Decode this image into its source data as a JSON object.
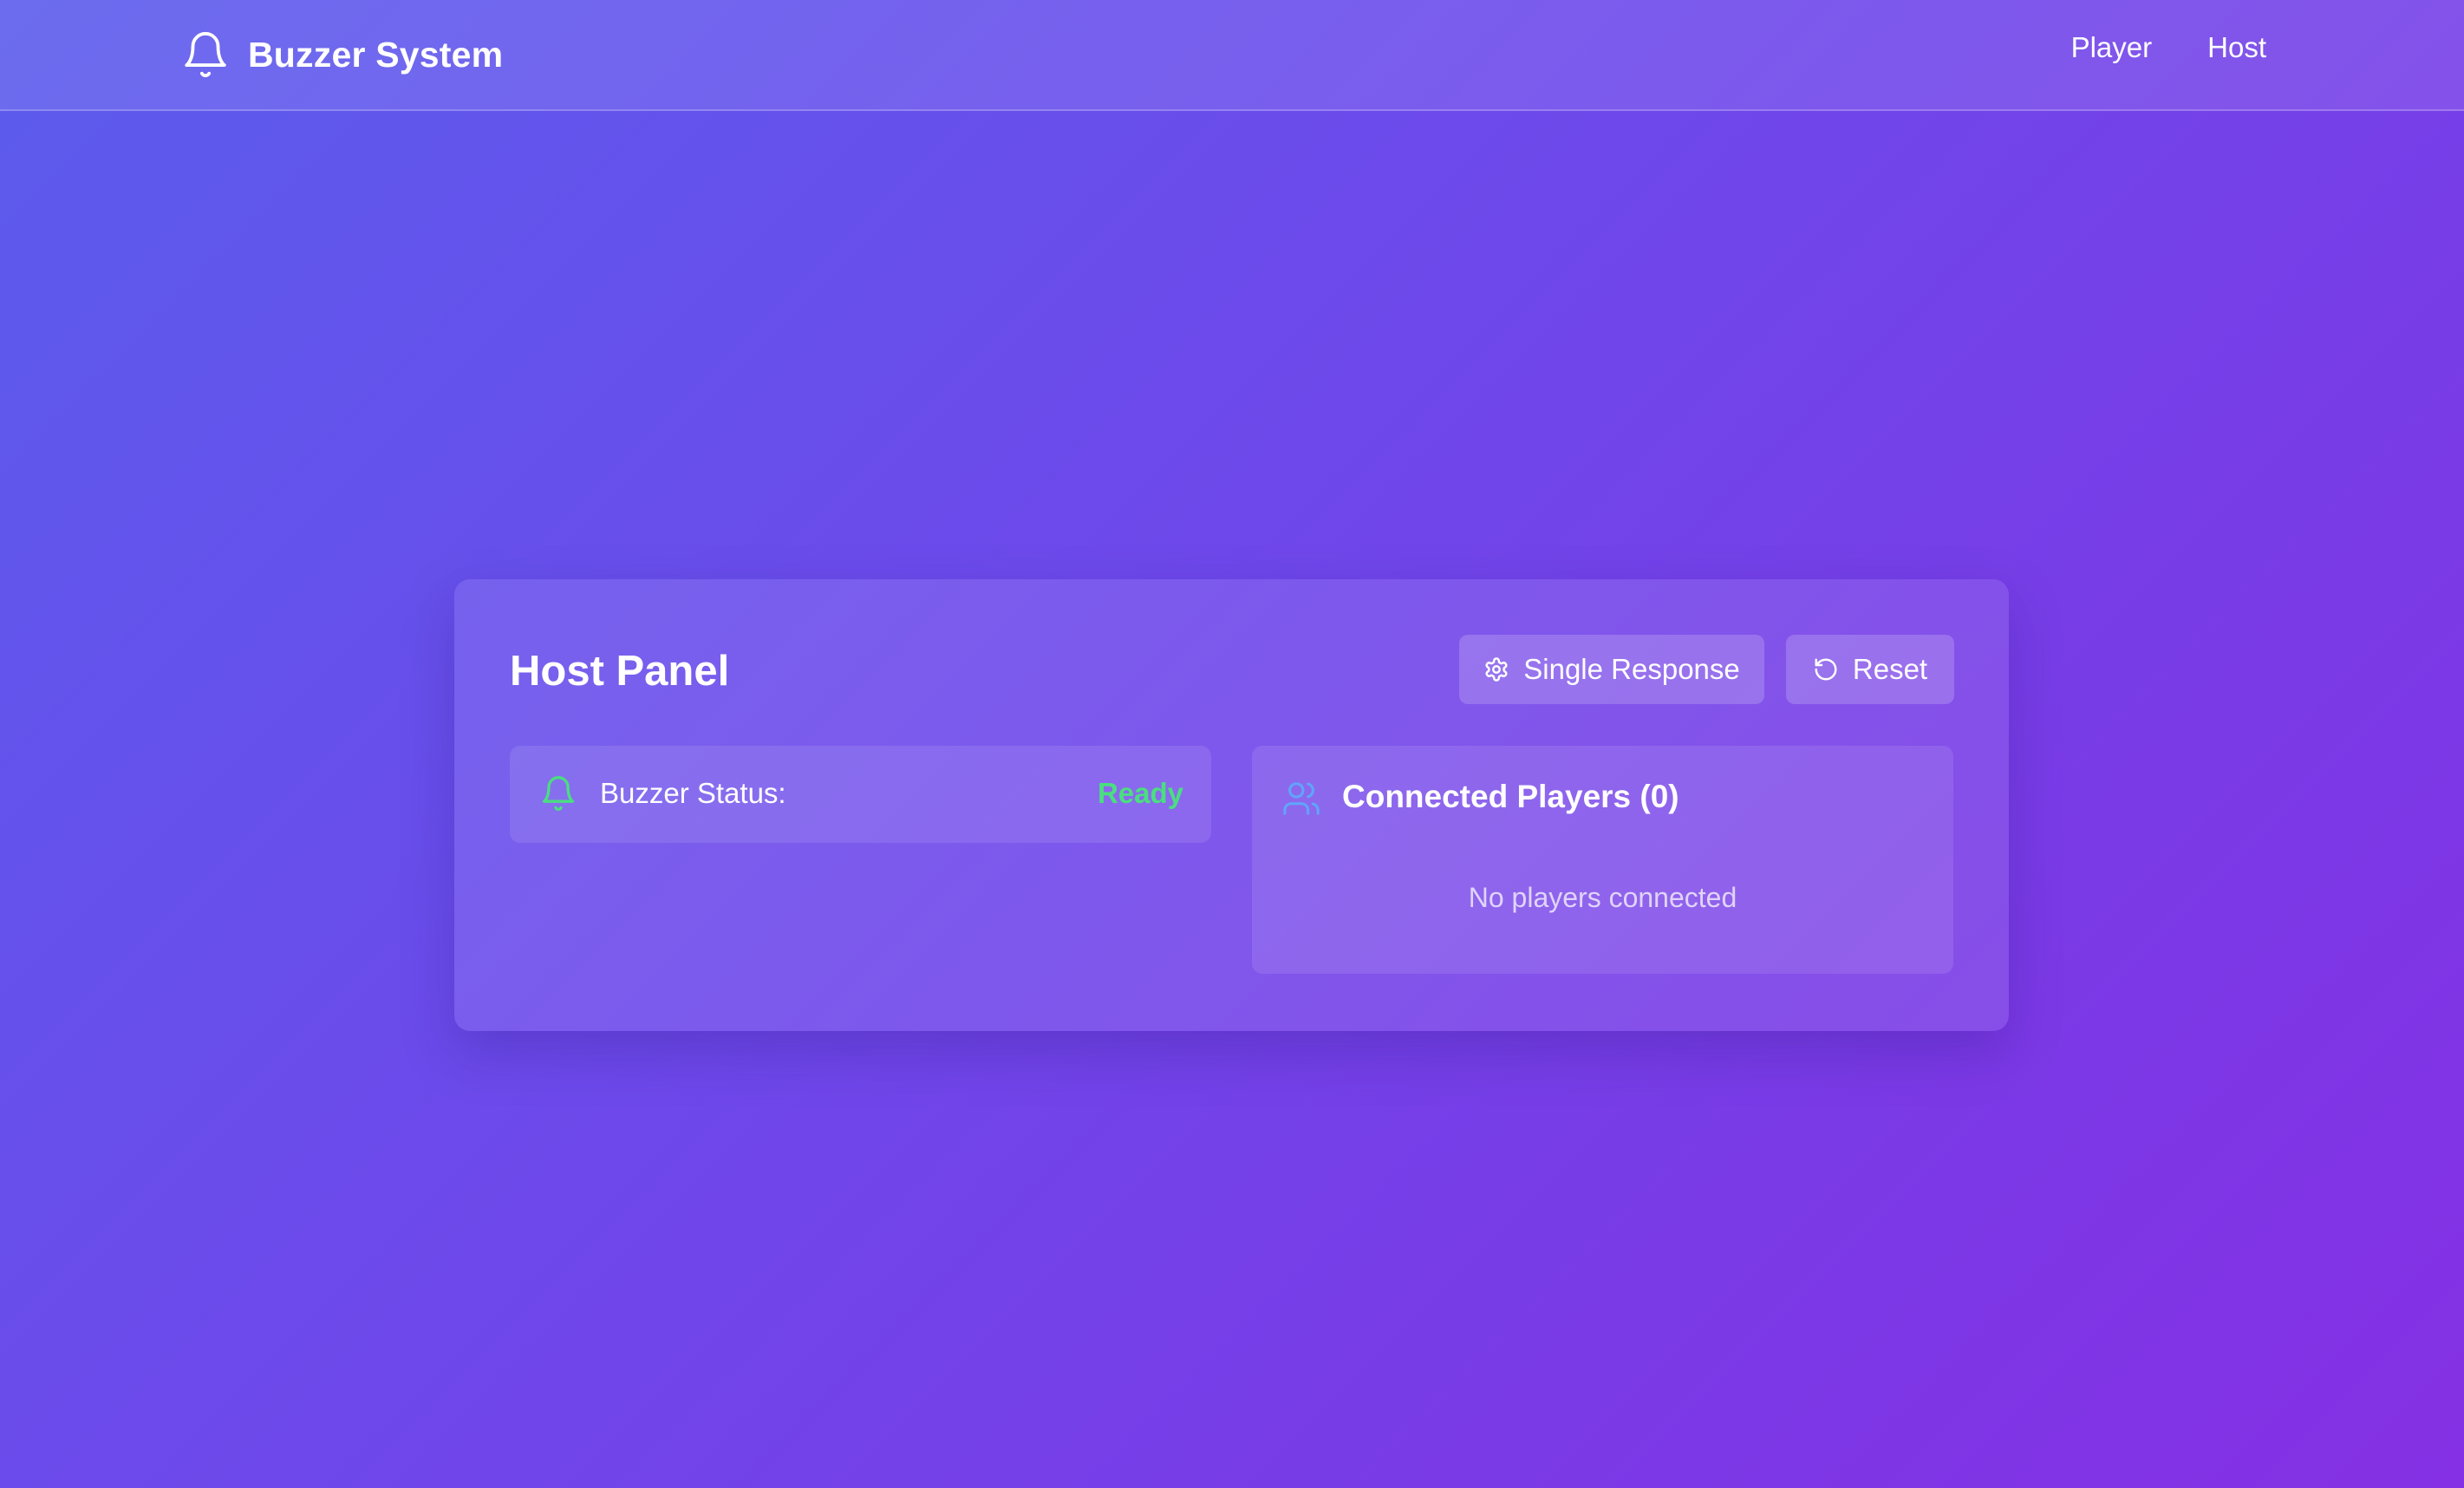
{
  "app": {
    "title": "Buzzer System",
    "icon": "bell-icon"
  },
  "nav": {
    "links": [
      {
        "label": "Player"
      },
      {
        "label": "Host"
      }
    ]
  },
  "panel": {
    "title": "Host Panel",
    "buttons": {
      "single_response": {
        "label": "Single Response",
        "icon": "gear-icon"
      },
      "reset": {
        "label": "Reset",
        "icon": "rotate-ccw-icon"
      }
    },
    "buzzer_status": {
      "label": "Buzzer Status:",
      "value": "Ready",
      "value_color": "#4ade80",
      "icon": "bell-icon"
    },
    "players": {
      "title": "Connected Players (0)",
      "empty_message": "No players connected",
      "icon": "users-icon",
      "icon_color": "#60a5fa"
    }
  },
  "colors": {
    "background_start": "#5b5cec",
    "background_end": "#8530e4",
    "status_ready": "#4ade80",
    "players_icon": "#60a5fa"
  }
}
